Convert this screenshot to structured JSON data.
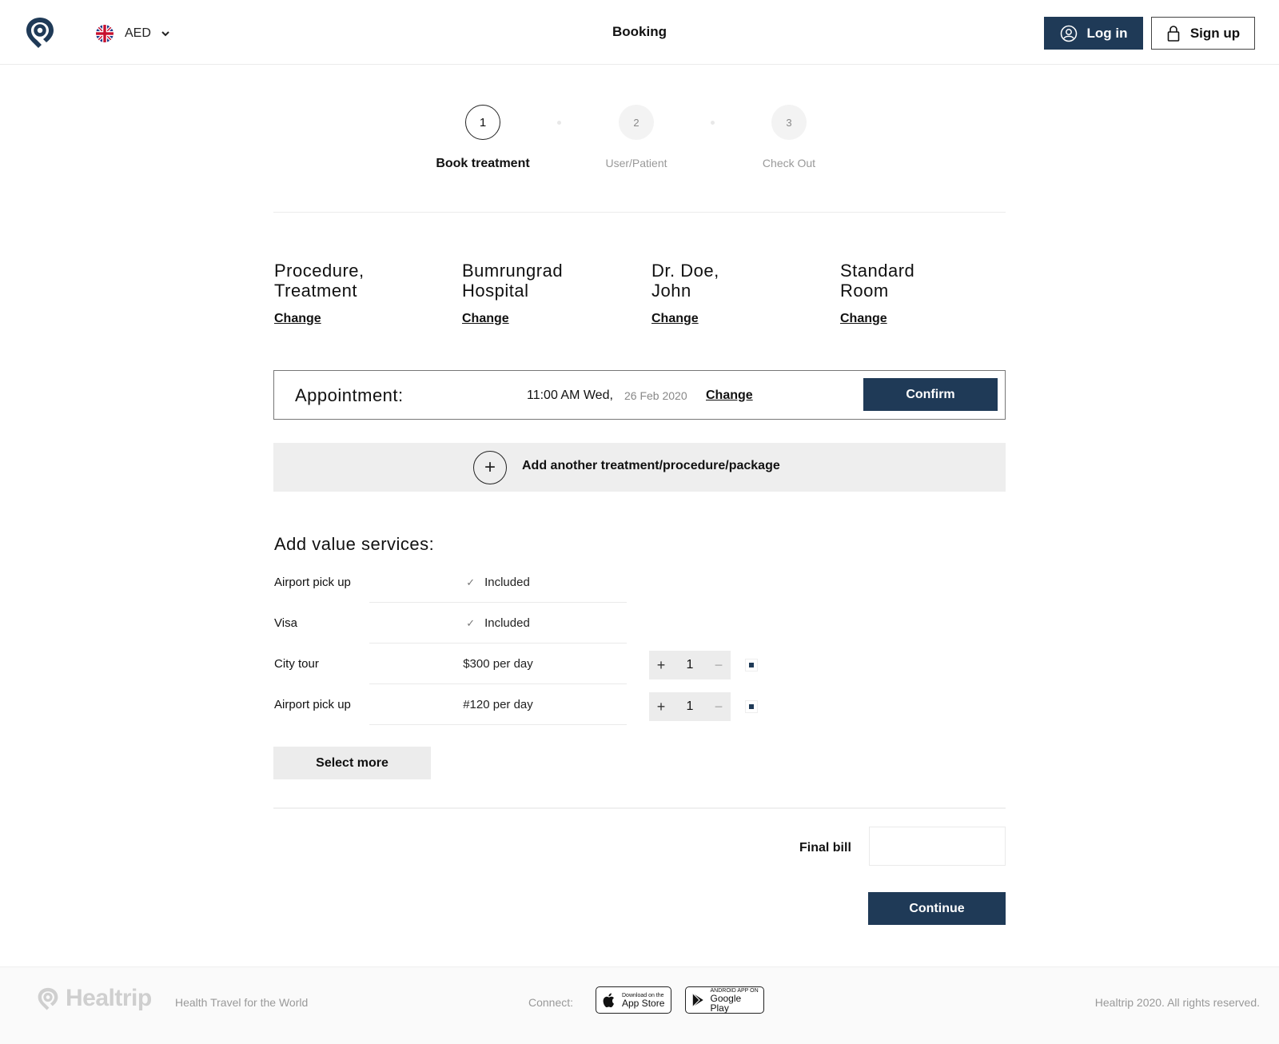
{
  "header": {
    "currency": "AED",
    "title": "Booking",
    "login_label": "Log in",
    "signup_label": "Sign up"
  },
  "stepper": {
    "steps": [
      {
        "number": "1",
        "label": "Book treatment",
        "state": "active"
      },
      {
        "number": "2",
        "label": "User/Patient",
        "state": "inactive"
      },
      {
        "number": "3",
        "label": "Check Out",
        "state": "inactive"
      }
    ]
  },
  "selections": [
    {
      "line1": "Procedure,",
      "line2": "Treatment",
      "change": "Change"
    },
    {
      "line1": "Bumrungrad",
      "line2": "Hospital",
      "change": "Change"
    },
    {
      "line1": "Dr. Doe,",
      "line2": "John",
      "change": "Change"
    },
    {
      "line1": "Standard",
      "line2": "Room",
      "change": "Change"
    }
  ],
  "appointment": {
    "label": "Appointment:",
    "time": "11:00 AM Wed,",
    "date": "26 Feb 2020",
    "change": "Change",
    "confirm": "Confirm"
  },
  "add_another": {
    "icon": "+",
    "label": "Add another treatment/procedure/package"
  },
  "services": {
    "heading": "Add value services:",
    "rows": [
      {
        "label": "Airport pick up",
        "value": "Included",
        "included": true
      },
      {
        "label": "Visa",
        "value": "Included",
        "included": true
      },
      {
        "label": "City tour",
        "value": "$300 per day",
        "included": false,
        "quantity": "1",
        "plus": "+",
        "minus": "−",
        "checked": true
      },
      {
        "label": "Airport pick up",
        "value": "#120 per day",
        "included": false,
        "quantity": "1",
        "plus": "+",
        "minus": "−",
        "checked": true
      }
    ],
    "select_more": "Select more"
  },
  "bill": {
    "label": "Final bill",
    "value": "",
    "continue": "Continue"
  },
  "footer": {
    "brand": "Healtrip",
    "tagline": "Health Travel for the World",
    "connect": "Connect:",
    "app_store_small": "Download on the",
    "app_store_big": "App Store",
    "google_small": "ANDROID APP ON",
    "google_big": "Google Play",
    "copyright": "Healtrip 2020. All rights reserved."
  },
  "colors": {
    "primary": "#1f3a57",
    "muted_bg": "#eeeeee"
  }
}
